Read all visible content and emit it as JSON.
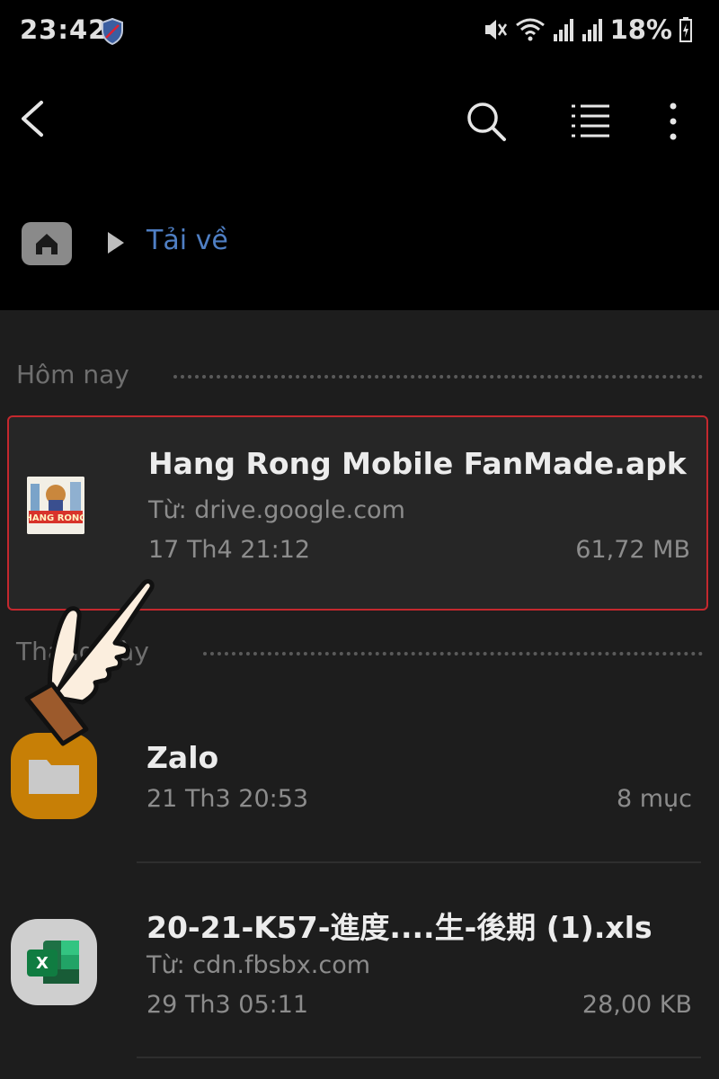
{
  "status_bar": {
    "time": "23:42",
    "battery": "18%",
    "icons": [
      "vpn-shield-icon",
      "mute-icon",
      "wifi-icon",
      "signal-icon",
      "signal-icon",
      "battery-icon"
    ]
  },
  "toolbar": {
    "icons": [
      "back-arrow-icon",
      "search-icon",
      "list-view-icon",
      "more-vert-icon"
    ]
  },
  "breadcrumb": {
    "home_icon": "home-icon",
    "current": "Tải về"
  },
  "sections": [
    {
      "label": "Hôm nay"
    },
    {
      "label": "Tháng này"
    }
  ],
  "files": [
    {
      "name": "Hang Rong Mobile FanMade.apk",
      "source": "Từ: drive.google.com",
      "date": "17 Th4 21:12",
      "size": "61,72 MB",
      "thumb_text": "HANG RONG",
      "selected": true
    },
    {
      "name": "Zalo",
      "date": "21 Th3 20:53",
      "size": "8 mục",
      "icon": "folder-icon"
    },
    {
      "name": "20-21-K57-進度....生-後期 (1).xls",
      "source": "Từ: cdn.fbsbx.com",
      "date": "29 Th3 05:11",
      "size": "28,00 KB",
      "icon": "excel-icon",
      "icon_letter": "X"
    }
  ],
  "colors": {
    "accent": "#4f7fc4",
    "selection_border": "#c4282e",
    "folder": "#c77f06",
    "excel": "#1e7145"
  }
}
